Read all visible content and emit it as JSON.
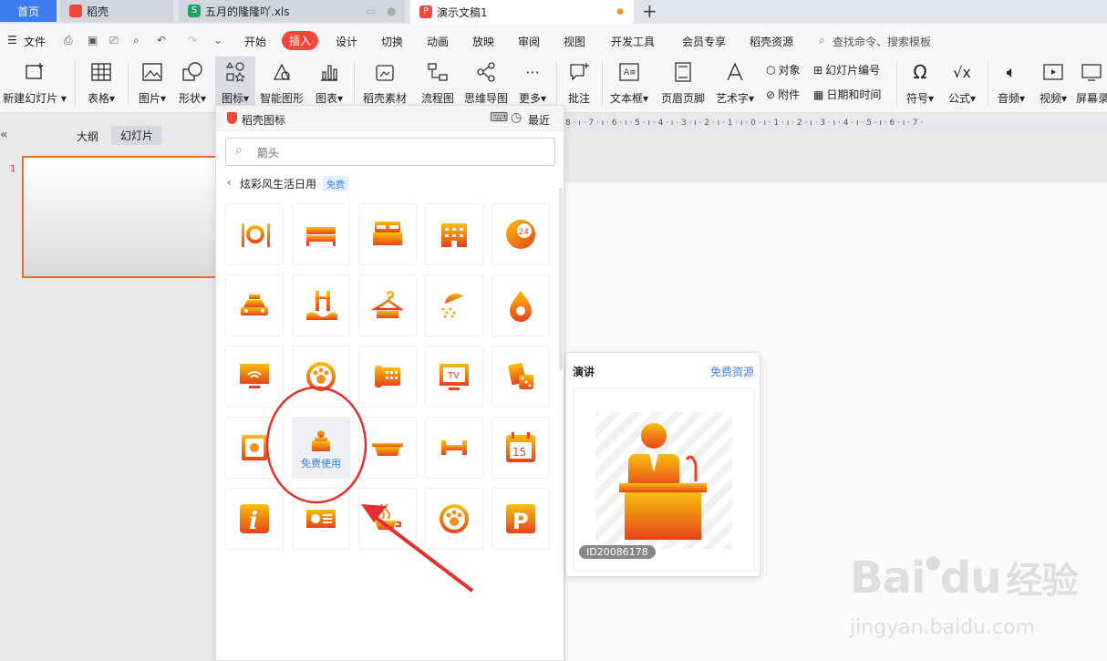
{
  "tabs": {
    "home": "首页",
    "daoke": "稻壳",
    "xls": "五月的隆隆吖.xls",
    "ppt": "演示文稿1"
  },
  "menu": {
    "file": "文件",
    "items": [
      "开始",
      "插入",
      "设计",
      "切换",
      "动画",
      "放映",
      "审阅",
      "视图",
      "开发工具",
      "会员专享",
      "稻壳资源"
    ],
    "search": "查找命令、搜索模板"
  },
  "ribbon": {
    "new_slide": "新建幻灯片",
    "table": "表格",
    "picture": "图片",
    "shape": "形状",
    "icon": "图标",
    "smart": "智能图形",
    "chart": "图表",
    "material": "稻壳素材",
    "flow": "流程图",
    "mind": "思维导图",
    "more": "更多",
    "comment": "批注",
    "textbox": "文本框",
    "header": "页眉页脚",
    "art": "艺术字",
    "object": "对象",
    "slide_no": "幻灯片编号",
    "attach": "附件",
    "datetime": "日期和时间",
    "symbol": "符号",
    "formula": "公式",
    "audio": "音频",
    "video": "视频",
    "screen": "屏幕录"
  },
  "leftpane": {
    "outline": "大纲",
    "slides": "幻灯片",
    "slide_num": "1"
  },
  "ruler_text": "8 · ı · 7 · ı · 6 · ı · 5 · ı · 4 · ı · 3 · ı · 2 · ı · 1 · ı · 0 · ı · 1 · ı · 2 · ı · 3 · ı · 4 · ı · 5 · ı · 6 · ı · 7 ·",
  "panel": {
    "title": "稻壳图标",
    "recent": "最近",
    "search_value": "箭头",
    "category": "炫彩风生活日用",
    "badge": "免费",
    "hover_label": "免费使用"
  },
  "icons": [
    "dining-icon",
    "bed-icon",
    "double-bed-icon",
    "hotel-building-icon",
    "phone-24-icon",
    "taxi-icon",
    "pool-icon",
    "hanger-icon",
    "shower-icon",
    "spa-icon",
    "wifi-monitor-icon",
    "paw-icon",
    "telephone-icon",
    "tv-icon",
    "cards-dice-icon",
    "safe-icon",
    "speaker-podium-icon",
    "bathtub-icon",
    "dumbbell-icon",
    "calendar-icon",
    "info-icon",
    "card-icon",
    "coffee-icon",
    "pet-icon",
    "parking-icon"
  ],
  "icon_texts": {
    "phone": "24",
    "tv": "TV",
    "calendar": "15",
    "info": "i",
    "parking": "P"
  },
  "preview": {
    "title": "演讲",
    "link": "免费资源",
    "id": "ID20086178"
  },
  "watermark": {
    "brand": "Bai",
    "brand2": "du",
    "cn": "经验",
    "url": "jingyan.baidu.com"
  },
  "colors": {
    "accent": "#f0473b",
    "blue": "#3c7ef2",
    "grad_top": "#f6b40a",
    "grad_bottom": "#e8431a"
  }
}
